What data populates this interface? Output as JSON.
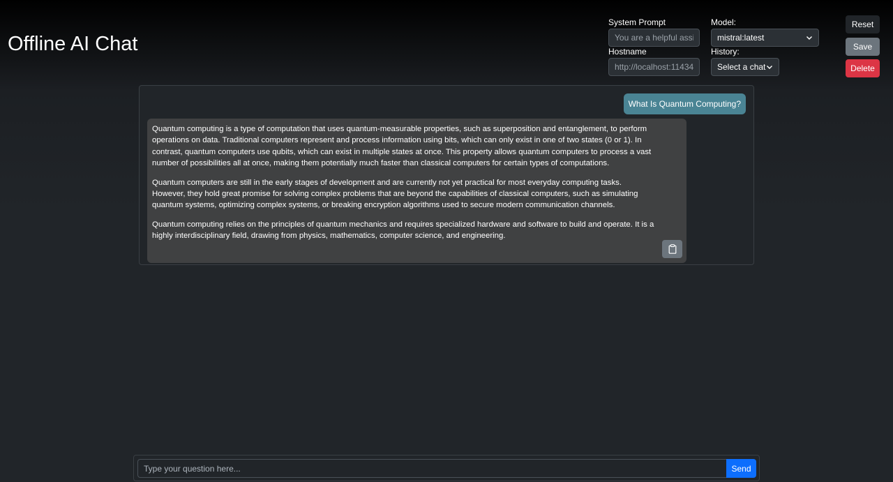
{
  "app": {
    "title": "Offline AI Chat"
  },
  "settings": {
    "system_prompt_label": "System Prompt",
    "system_prompt_placeholder": "You are a helpful assistant.",
    "hostname_label": "Hostname",
    "hostname_placeholder": "http://localhost:11434",
    "model_label": "Model:",
    "model_value": "mistral:latest",
    "history_label": "History:",
    "history_value": "Select a chat"
  },
  "actions": {
    "reset_label": "Reset",
    "save_label": "Save",
    "delete_label": "Delete"
  },
  "chat": {
    "messages": [
      {
        "role": "user",
        "text": "What Is Quantum Computing?"
      },
      {
        "role": "assistant",
        "paragraphs": [
          "Quantum computing is a type of computation that uses quantum-measurable properties, such as superposition and entanglement, to perform operations on data. Traditional computers represent and process information using bits, which can only exist in one of two states (0 or 1). In contrast, quantum computers use qubits, which can exist in multiple states at once. This property allows quantum computers to process a vast number of possibilities all at once, making them potentially much faster than classical computers for certain types of computations.",
          "Quantum computers are still in the early stages of development and are currently not yet practical for most everyday computing tasks. However, they hold great promise for solving complex problems that are beyond the capabilities of classical computers, such as simulating quantum systems, optimizing complex systems, or breaking encryption algorithms used to secure modern communication channels.",
          "Quantum computing relies on the principles of quantum mechanics and requires specialized hardware and software to build and operate. It is a highly interdisciplinary field, drawing from physics, mathematics, computer science, and engineering."
        ],
        "copy_icon": "clipboard-icon"
      }
    ]
  },
  "composer": {
    "placeholder": "Type your question here...",
    "send_label": "Send"
  },
  "colors": {
    "user_bubble": "#4a8494",
    "assistant_bubble": "#404142",
    "send": "#0d6efd",
    "delete": "#dc3545",
    "save": "#6c757d"
  }
}
